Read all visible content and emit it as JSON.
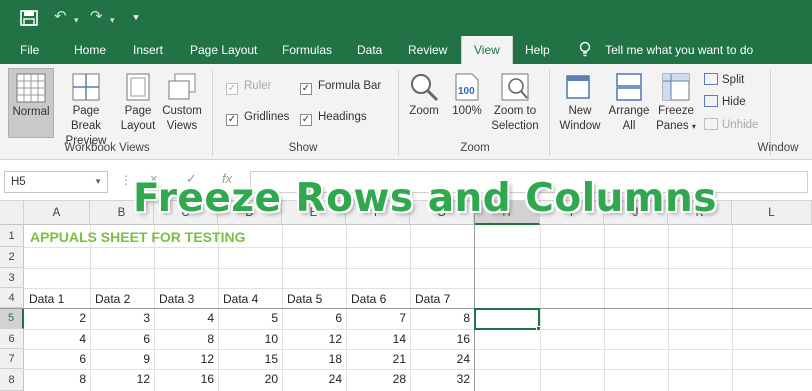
{
  "quick_access": {
    "save_icon": "save-icon",
    "undo_icon": "undo-icon",
    "redo_icon": "redo-icon",
    "customize_icon": "customize-toolbar-icon",
    "undo_glyph": "↶",
    "redo_glyph": "↷",
    "dropdown_glyph": "▾",
    "customize_glyph": "⯆"
  },
  "tabs": [
    "File",
    "Home",
    "Insert",
    "Page Layout",
    "Formulas",
    "Data",
    "Review",
    "View",
    "Help"
  ],
  "active_tab": "View",
  "tell_me": "Tell me what you want to do",
  "ribbon": {
    "workbook_views": {
      "label": "Workbook Views",
      "normal": "Normal",
      "page_break_1": "Page Break",
      "page_break_2": "Preview",
      "page_layout_1": "Page",
      "page_layout_2": "Layout",
      "custom_views_1": "Custom",
      "custom_views_2": "Views"
    },
    "show": {
      "label": "Show",
      "ruler": "Ruler",
      "formula_bar": "Formula Bar",
      "gridlines": "Gridlines",
      "headings": "Headings"
    },
    "zoom": {
      "label": "Zoom",
      "zoom": "Zoom",
      "hundred": "100%",
      "zoom_to_1": "Zoom to",
      "zoom_to_2": "Selection"
    },
    "window": {
      "label": "Window",
      "new_window_1": "New",
      "new_window_2": "Window",
      "arrange_1": "Arrange",
      "arrange_2": "All",
      "freeze_1": "Freeze",
      "freeze_2": "Panes",
      "split": "Split",
      "hide": "Hide",
      "unhide": "Unhide"
    }
  },
  "formula_bar": {
    "name_box": "H5",
    "dots": "⋮",
    "cancel": "×",
    "enter": "✓",
    "fx": "fx",
    "value": ""
  },
  "columns": [
    "A",
    "B",
    "C",
    "D",
    "E",
    "F",
    "G",
    "H",
    "I",
    "J",
    "K",
    "L"
  ],
  "selected_column": "H",
  "rows": [
    "1",
    "2",
    "3",
    "4",
    "5",
    "6",
    "7",
    "8"
  ],
  "selected_row": "5",
  "sheet_title": "APPUALS SHEET FOR TESTING",
  "headers": [
    "Data 1",
    "Data 2",
    "Data 3",
    "Data 4",
    "Data 5",
    "Data 6",
    "Data 7"
  ],
  "data_rows": [
    [
      2,
      3,
      4,
      5,
      6,
      7,
      8
    ],
    [
      4,
      6,
      8,
      10,
      12,
      14,
      16
    ],
    [
      6,
      9,
      12,
      15,
      18,
      21,
      24
    ],
    [
      8,
      12,
      16,
      20,
      24,
      28,
      32
    ]
  ],
  "headline": "Freeze Rows and Columns",
  "colors": {
    "brand": "#217346",
    "title_green": "#7ac043",
    "headline_green": "#2fa84f"
  }
}
